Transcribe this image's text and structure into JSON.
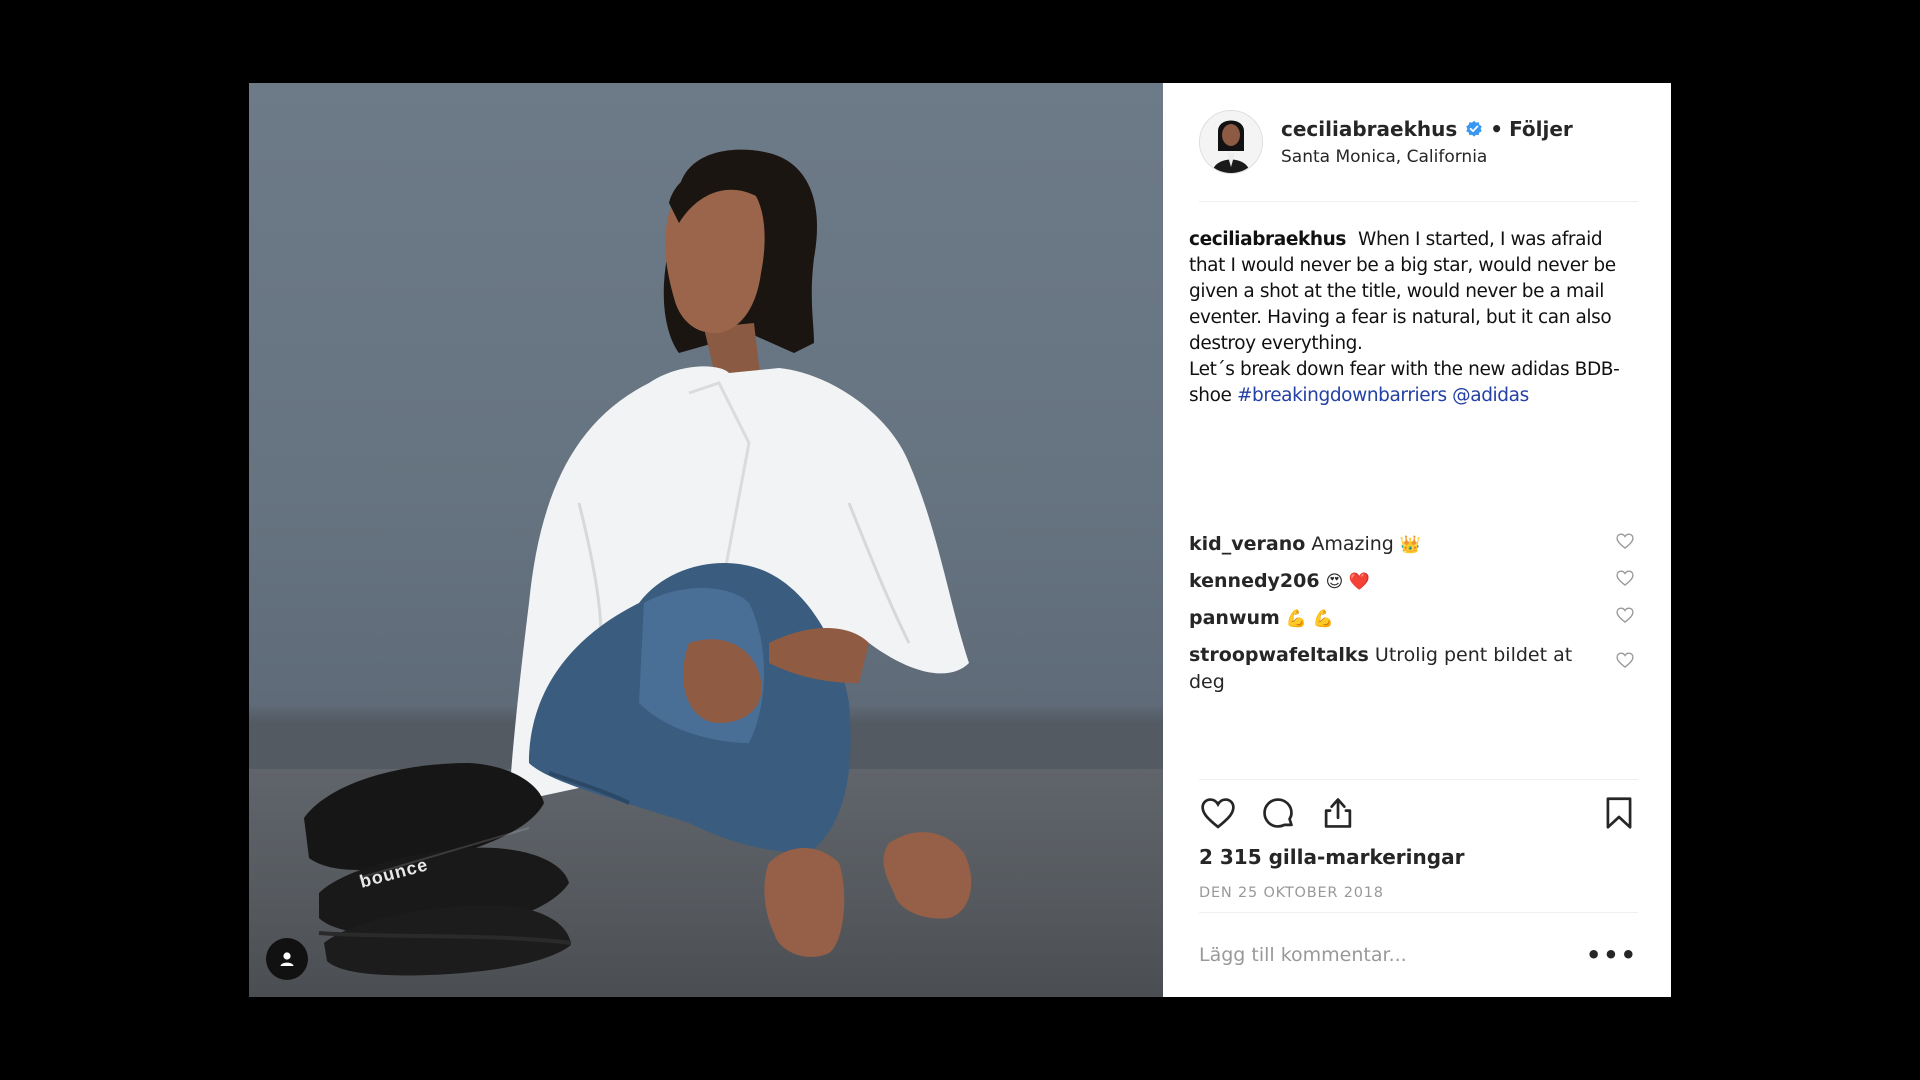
{
  "post": {
    "username": "ceciliabraekhus",
    "separator": "•",
    "follow_label": "Följer",
    "location": "Santa Monica, California",
    "caption": {
      "username": "ceciliabraekhus",
      "text": "When I started, I was afraid that I would never be a big star, would never be given a shot at the title, would never be a mail eventer. Having a fear is natural, but it can also destroy everything.",
      "text2": "Let´s break down fear with the new adidas BDB-shoe",
      "hashtag": "#breakingdownbarriers",
      "mention": "@adidas"
    },
    "comments": [
      {
        "user": "kid_verano",
        "text": "Amazing",
        "emoji": "👑"
      },
      {
        "user": "kennedy206",
        "text": "",
        "emoji": "😍 ❤️"
      },
      {
        "user": "panwum",
        "text": "",
        "emoji": "💪 💪"
      },
      {
        "user": "stroopwafeltalks",
        "text": "Utrolig pent bildet at deg",
        "emoji": ""
      }
    ],
    "likes": "2 315 gilla-markeringar",
    "date": "DEN 25 OKTOBER 2018",
    "comment_placeholder": "Lägg till kommentar...",
    "more_label": "•••",
    "shoe_text": "bounce",
    "icons": {
      "verified": "verified-badge-icon",
      "like": "heart-icon",
      "comment": "comment-bubble-icon",
      "share": "share-icon",
      "save": "bookmark-icon",
      "user_tag": "user-tag-icon"
    },
    "colors": {
      "verified": "#3897f0",
      "link": "#2440a4",
      "muted": "#999999"
    }
  }
}
